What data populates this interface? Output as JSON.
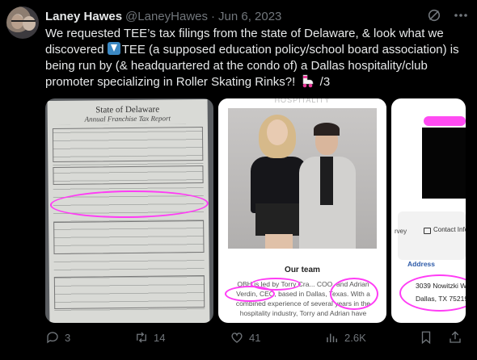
{
  "author": {
    "name": "Laney Hawes",
    "handle": "@LaneyHawes",
    "separator": "·",
    "date": "Jun 6, 2023"
  },
  "tweet": {
    "line1": "We requested TEE’s tax filings from the state of Delaware, & look what we",
    "line2_pre": "discovered ",
    "line2_post": "TEE (a supposed education policy/school board association) is",
    "line3": "being run by (& headquartered at the condo of) a Dallas hospitality/club",
    "line4_pre": "promoter specializing in Roller Skating Rinks?! ",
    "line4_post": " /3"
  },
  "media": {
    "doc": {
      "title": "State of Delaware",
      "subtitle": "Annual Franchise Tax Report"
    },
    "team": {
      "header": "HOSPITALITY",
      "title": "Our team",
      "text": "OBH is led by Torry Cra... COO, and Adrian Verdin, CEO, based in Dallas, Texas. With a combined experience of several years in the hospitality industry, Torry and Adrian have"
    },
    "contact": {
      "survey_text": "rvey",
      "contact_text": "Contact Info",
      "address_label": "Address",
      "address_line1": "3039 Nowitzki W",
      "address_line2": "Dallas, TX 75219"
    }
  },
  "actions": {
    "replies": "3",
    "retweets": "14",
    "likes": "41",
    "views": "2.6K"
  },
  "colors": {
    "background": "#000000",
    "text": "#e7e9ea",
    "muted": "#71767b",
    "highlight": "#ff3cf5"
  },
  "icons": [
    "grok-icon",
    "more-icon",
    "down-arrow-emoji",
    "roller-skate-emoji",
    "reply-icon",
    "retweet-icon",
    "like-icon",
    "views-icon",
    "bookmark-icon",
    "share-icon"
  ]
}
